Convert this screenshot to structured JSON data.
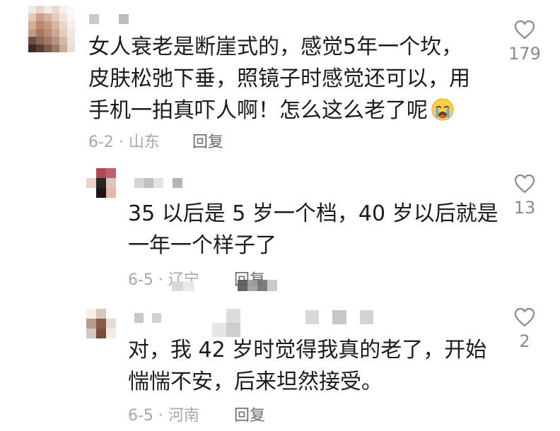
{
  "comments": [
    {
      "text_lines": [
        "女人衰老是断崖式的，感觉5年一个坎，",
        "皮肤松弛下垂，照镜子时感觉还可以，用",
        "手机一拍真吓人啊！怎么这么老了呢"
      ],
      "emoji_icon": "crying-face-icon",
      "date_location": "6-2 · 山东",
      "reply_label": "回复",
      "like_count": "179"
    },
    {
      "text_lines": [
        "35 以后是 5 岁一个档，40 岁以后就是",
        "一年一个样子了"
      ],
      "date_location": "6-5 · 辽宁",
      "reply_label": "回复",
      "like_count": "13"
    },
    {
      "text_lines": [
        "对，我 42 岁时觉得我真的老了，开始",
        "惴惴不安，后来坦然接受。"
      ],
      "date_location": "6-5 · 河南",
      "reply_label": "回复",
      "like_count": "2"
    }
  ],
  "icons": {
    "like": "heart-outline-icon"
  },
  "colors": {
    "text": "#1b1b1b",
    "meta": "#a8a8a8",
    "reply": "#6b6b6b",
    "like_count": "#8a8a8a"
  }
}
